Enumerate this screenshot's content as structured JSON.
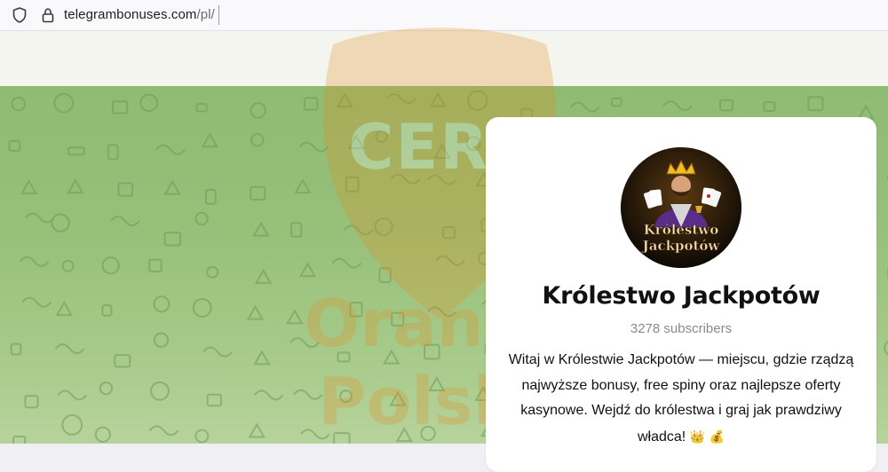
{
  "browser": {
    "url_host": "telegrambonuses.com",
    "url_path": "/pl/"
  },
  "watermark": {
    "top": "CERT",
    "middle": "Orange",
    "bottom": "Polska"
  },
  "channel": {
    "avatar_text_line1": "Królestwo",
    "avatar_text_line2": "Jackpotów",
    "name": "Królestwo Jackpotów",
    "subscribers": "3278 subscribers",
    "description": "Witaj w Królestwie Jackpotów — miejscu, gdzie rządzą najwyższe bonusy, free spiny oraz najlepsze oferty kasynowe. Wejdź do królestwa i graj jak prawdziwy władca!",
    "emoji_1": "👑",
    "emoji_2": "💰"
  },
  "colors": {
    "background_green": "#97c079",
    "watermark_orange": "#e78a1a",
    "card": "#ffffff"
  }
}
